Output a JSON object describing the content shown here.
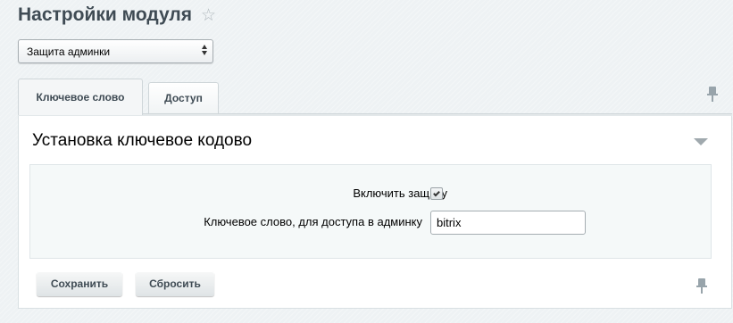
{
  "header": {
    "title": "Настройки модуля",
    "favorite_icon": "star-icon"
  },
  "module_select": {
    "value": "Защита админки"
  },
  "tabs": [
    {
      "label": "Ключевое слово",
      "active": true
    },
    {
      "label": "Доступ",
      "active": false
    }
  ],
  "section": {
    "title": "Установка ключевое кодово"
  },
  "form": {
    "enable_protection_label": "Включить защиту",
    "enable_protection_checked": true,
    "keyword_label": "Ключевое слово, для доступа в админку",
    "keyword_value": "bitrix"
  },
  "buttons": {
    "save_label": "Сохранить",
    "reset_label": "Сбросить"
  },
  "icons": {
    "pin": "pin-icon",
    "collapse": "collapse-arrow-icon"
  }
}
